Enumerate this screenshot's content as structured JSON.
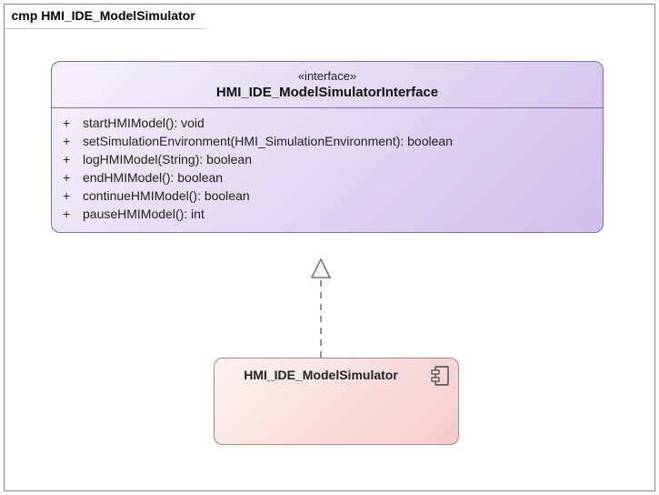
{
  "frame": {
    "label_prefix": "cmp ",
    "label_name": "HMI_IDE_ModelSimulator"
  },
  "interface": {
    "stereotype": "«interface»",
    "name": "HMI_IDE_ModelSimulatorInterface",
    "operations": [
      {
        "visibility": "+",
        "signature": "startHMIModel(): void"
      },
      {
        "visibility": "+",
        "signature": "setSimulationEnvironment(HMI_SimulationEnvironment): boolean"
      },
      {
        "visibility": "+",
        "signature": "logHMIModel(String): boolean"
      },
      {
        "visibility": "+",
        "signature": "endHMIModel(): boolean"
      },
      {
        "visibility": "+",
        "signature": "continueHMIModel(): boolean"
      },
      {
        "visibility": "+",
        "signature": "pauseHMIModel(): int"
      }
    ]
  },
  "component": {
    "name": "HMI_IDE_ModelSimulator"
  },
  "relationship": {
    "type": "realization",
    "from": "HMI_IDE_ModelSimulator",
    "to": "HMI_IDE_ModelSimulatorInterface"
  }
}
